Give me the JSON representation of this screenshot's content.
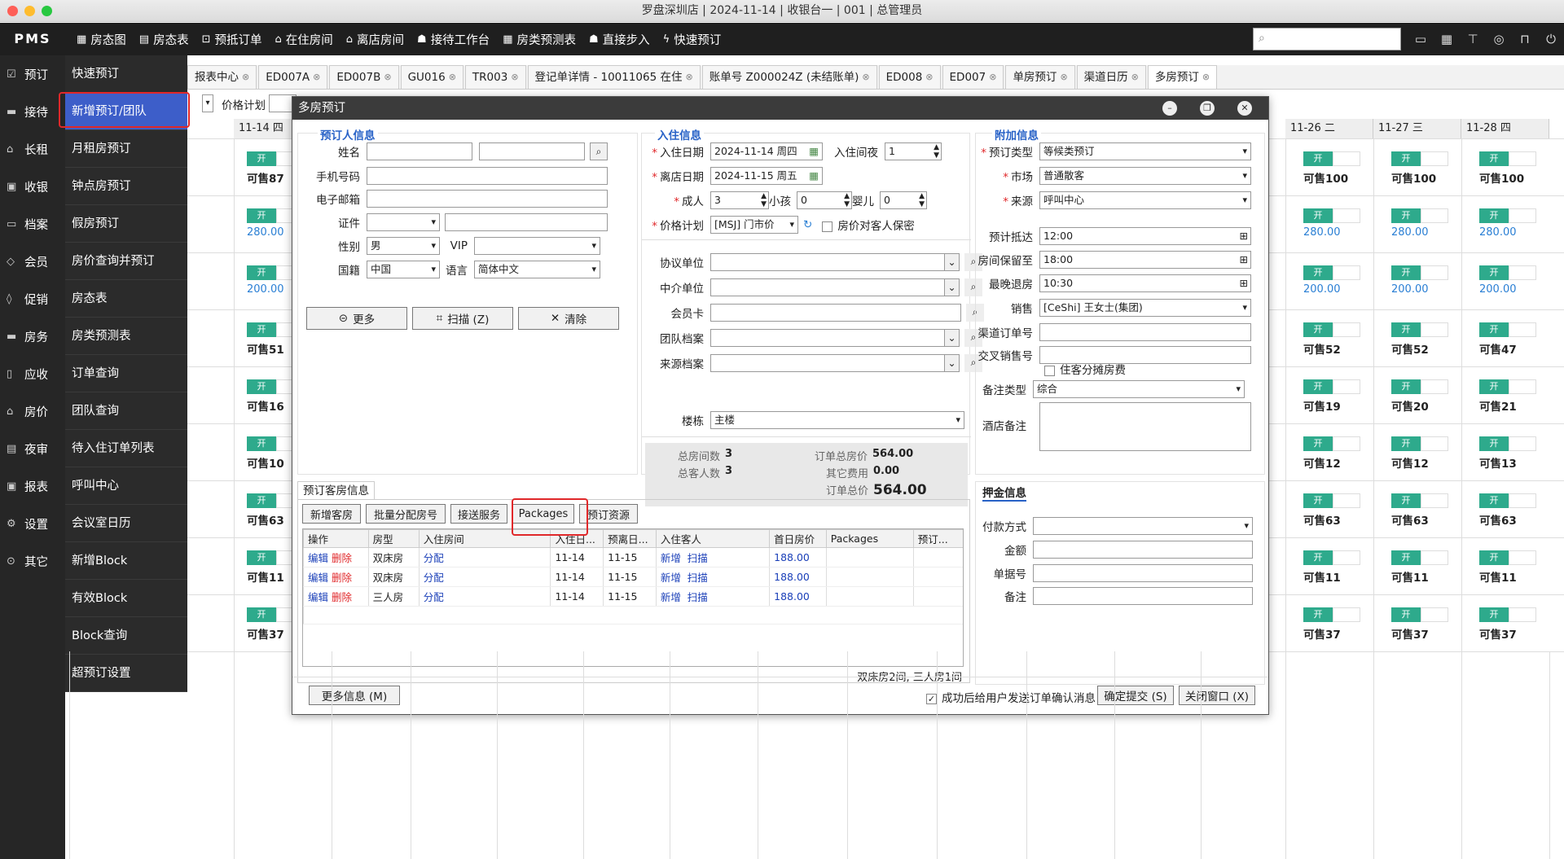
{
  "window": {
    "title": "罗盘深圳店 | 2024-11-14 | 收银台一 | 001 | 总管理员"
  },
  "topnav": {
    "logo": "PMS",
    "items": [
      {
        "label": "房态图",
        "icon": "grid-icon"
      },
      {
        "label": "房态表",
        "icon": "table-icon"
      },
      {
        "label": "预抵订单",
        "icon": "arrival-icon"
      },
      {
        "label": "在住房间",
        "icon": "home-icon"
      },
      {
        "label": "离店房间",
        "icon": "home-out-icon"
      },
      {
        "label": "接待工作台",
        "icon": "reception-icon"
      },
      {
        "label": "房类预测表",
        "icon": "forecast-icon"
      },
      {
        "label": "直接步入",
        "icon": "walkin-icon"
      },
      {
        "label": "快速预订",
        "icon": "lightning-icon"
      }
    ]
  },
  "sidebar": {
    "items": [
      {
        "label": "预订",
        "icon": "checkbox-icon"
      },
      {
        "label": "接待",
        "icon": "bed-icon"
      },
      {
        "label": "长租",
        "icon": "house-icon"
      },
      {
        "label": "收银",
        "icon": "cashier-icon"
      },
      {
        "label": "档案",
        "icon": "archive-icon"
      },
      {
        "label": "会员",
        "icon": "diamond-icon"
      },
      {
        "label": "促销",
        "icon": "tag-icon"
      },
      {
        "label": "房务",
        "icon": "bed-icon"
      },
      {
        "label": "应收",
        "icon": "receivable-icon"
      },
      {
        "label": "房价",
        "icon": "price-icon"
      },
      {
        "label": "夜审",
        "icon": "audit-icon"
      },
      {
        "label": "报表",
        "icon": "report-icon"
      },
      {
        "label": "设置",
        "icon": "gear-icon"
      },
      {
        "label": "其它",
        "icon": "more-icon"
      }
    ]
  },
  "flyout": {
    "items": [
      "快速预订",
      "新增预订/团队",
      "月租房预订",
      "钟点房预订",
      "假房预订",
      "房价查询并预订",
      "房态表",
      "房类预测表",
      "订单查询",
      "团队查询",
      "待入住订单列表",
      "呼叫中心",
      "会议室日历",
      "新增Block",
      "有效Block",
      "Block查询",
      "超预订设置"
    ]
  },
  "tabs": [
    "报表中心",
    "ED007A",
    "ED007B",
    "GU016",
    "TR003",
    "登记单详情 - 10011065 在住",
    "账单号 Z000024Z (未结账单)",
    "ED008",
    "ED007",
    "单房预订",
    "渠道日历",
    "多房预订"
  ],
  "filter": {
    "price_plan_label": "价格计划"
  },
  "calendar": {
    "left_header": "11-14 四",
    "right_headers": [
      "11-26 二",
      "11-27 三",
      "11-28 四"
    ],
    "kai_label": "开",
    "left_cells": [
      {
        "avail": "可售87"
      },
      {
        "price": "280.00"
      },
      {
        "price": "200.00"
      },
      {
        "avail": "可售51"
      },
      {
        "avail": "可售16"
      },
      {
        "avail": "可售10"
      },
      {
        "avail": "可售63"
      },
      {
        "avail": "可售11"
      },
      {
        "avail": "可售37"
      }
    ],
    "right_cols": [
      [
        "可售100",
        "280.00",
        "200.00",
        "可售52",
        "可售19",
        "可售12",
        "可售63",
        "可售11",
        "可售37"
      ],
      [
        "可售100",
        "280.00",
        "200.00",
        "可售52",
        "可售20",
        "可售12",
        "可售63",
        "可售11",
        "可售37"
      ],
      [
        "可售100",
        "280.00",
        "200.00",
        "可售47",
        "可售21",
        "可售13",
        "可售63",
        "可售11",
        "可售37"
      ]
    ]
  },
  "dialog": {
    "title": "多房预订",
    "booker": {
      "section_title": "预订人信息",
      "name_label": "姓名",
      "phone_label": "手机号码",
      "email_label": "电子邮箱",
      "id_label": "证件",
      "gender_label": "性别",
      "gender_value": "男",
      "vip_label": "VIP",
      "nationality_label": "国籍",
      "nationality_value": "中国",
      "language_label": "语言",
      "language_value": "简体中文",
      "more_btn": "更多",
      "scan_btn": "扫描 (Z)",
      "clear_btn": "清除"
    },
    "stay": {
      "section_title": "入住信息",
      "checkin_label": "入住日期",
      "checkin_value": "2024-11-14 周四",
      "nights_label": "入住间夜",
      "nights_value": "1",
      "checkout_label": "离店日期",
      "checkout_value": "2024-11-15 周五",
      "adult_label": "成人",
      "adult_value": "3",
      "child_label": "小孩",
      "child_value": "0",
      "infant_label": "婴儿",
      "infant_value": "0",
      "rate_plan_label": "价格计划",
      "rate_plan_value": "[MSJ] 门市价",
      "confidential_label": "房价对客人保密",
      "agreement_label": "协议单位",
      "agent_label": "中介单位",
      "member_label": "会员卡",
      "group_label": "团队档案",
      "source_file_label": "来源档案",
      "building_label": "楼栋",
      "building_value": "主楼",
      "total_rooms_label": "总房间数",
      "total_rooms_value": "3",
      "total_guests_label": "总客人数",
      "total_guests_value": "3",
      "order_room_total_label": "订单总房价",
      "order_room_total_value": "564.00",
      "other_fee_label": "其它费用",
      "other_fee_value": "0.00",
      "order_total_label": "订单总价",
      "order_total_value": "564.00"
    },
    "extra": {
      "section_title": "附加信息",
      "booking_type_label": "预订类型",
      "booking_type_value": "等候类预订",
      "market_label": "市场",
      "market_value": "普通散客",
      "source_label": "来源",
      "source_value": "呼叫中心",
      "eta_label": "预计抵达",
      "eta_value": "12:00",
      "hold_label": "房间保留至",
      "hold_value": "18:00",
      "latest_checkout_label": "最晚退房",
      "latest_checkout_value": "10:30",
      "sales_label": "销售",
      "sales_value": "[CeShi] 王女士(集团)",
      "channel_order_label": "渠道订单号",
      "cross_sale_label": "交叉销售号",
      "split_label": "住客分摊房费",
      "remark_type_label": "备注类型",
      "remark_type_value": "综合",
      "hotel_remark_label": "酒店备注"
    },
    "rooms": {
      "section_tab": "预订客房信息",
      "buttons": [
        "新增客房",
        "批量分配房号",
        "接送服务",
        "Packages",
        "预订资源"
      ],
      "columns": [
        "操作",
        "房型",
        "入住房间",
        "入住日...",
        "预离日...",
        "入住客人",
        "首日房价",
        "Packages",
        "预订..."
      ],
      "rows": [
        {
          "edit": "编辑",
          "del": "删除",
          "type": "双床房",
          "room": "分配",
          "in": "11-14",
          "out": "11-15",
          "add": "新增",
          "scan": "扫描",
          "price": "188.00"
        },
        {
          "edit": "编辑",
          "del": "删除",
          "type": "双床房",
          "room": "分配",
          "in": "11-14",
          "out": "11-15",
          "add": "新增",
          "scan": "扫描",
          "price": "188.00"
        },
        {
          "edit": "编辑",
          "del": "删除",
          "type": "三人房",
          "room": "分配",
          "in": "11-14",
          "out": "11-15",
          "add": "新增",
          "scan": "扫描",
          "price": "188.00"
        }
      ],
      "summary": "双床房2间, 三人房1间"
    },
    "deposit": {
      "section_title": "押金信息",
      "payment_label": "付款方式",
      "amount_label": "金额",
      "receipt_label": "单据号",
      "remark_label": "备注"
    },
    "footer": {
      "more_info_btn": "更多信息 (M)",
      "send_confirm_label": "成功后给用户发送订单确认消息",
      "submit_btn": "确定提交 (S)",
      "close_btn": "关闭窗口 (X)"
    }
  }
}
